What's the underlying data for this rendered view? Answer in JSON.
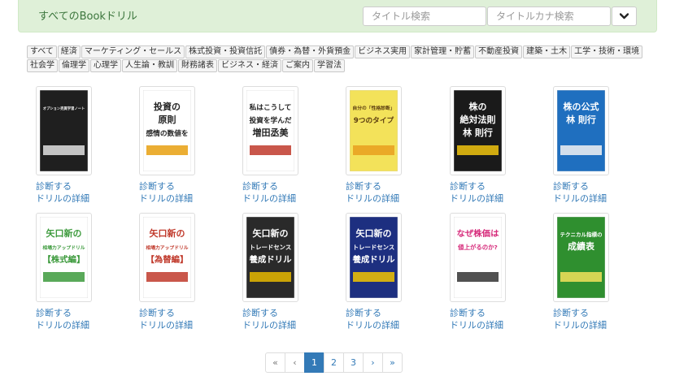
{
  "header": {
    "title": "すべてのBookドリル",
    "search_title_placeholder": "タイトル検索",
    "search_kana_placeholder": "タイトルカナ検索",
    "dropdown_icon": "chevron-down-icon"
  },
  "categories": [
    "すべて",
    "経済",
    "マーケティング・セールス",
    "株式投資・投資信託",
    "債券・為替・外貨預金",
    "ビジネス実用",
    "家計管理・貯蓄",
    "不動産投資",
    "建築・土木",
    "工学・技術・環境",
    "社会学",
    "倫理学",
    "心理学",
    "人生論・教訓",
    "財務諸表",
    "ビジネス・経済",
    "ご案内",
    "学習法"
  ],
  "book_link": {
    "line1": "診断する",
    "line2": "ドリルの詳細"
  },
  "books": [
    {
      "cover_lines": [
        "オプション売買学習ノート"
      ],
      "colors": [
        "#1f1f1f",
        "#f4f4f4",
        "#e0e0e0"
      ]
    },
    {
      "cover_lines": [
        "投資の",
        "原則",
        "感情の数値を"
      ],
      "colors": [
        "#ffffff",
        "#222222",
        "#e8a010"
      ]
    },
    {
      "cover_lines": [
        "私はこうして",
        "投資を学んだ",
        "増田丞美"
      ],
      "colors": [
        "#ffffff",
        "#222222",
        "#c0392b"
      ]
    },
    {
      "cover_lines": [
        "自分の「性格診断」",
        "9つのタイプ"
      ],
      "colors": [
        "#f3e25a",
        "#5a3b10",
        "#e89f1f"
      ]
    },
    {
      "cover_lines": [
        "株の",
        "絶対法則",
        "林 則行"
      ],
      "colors": [
        "#1a1a1a",
        "#ffffff",
        "#f1c40f"
      ]
    },
    {
      "cover_lines": [
        "株の公式",
        "林 則行"
      ],
      "colors": [
        "#1f6fbf",
        "#ffffff",
        "#f2f2f2"
      ]
    },
    {
      "cover_lines": [
        "矢口新の",
        "相場力アップドリル",
        "【株式編】"
      ],
      "colors": [
        "#ffffff",
        "#3c9a3c",
        "#3c9a3c"
      ]
    },
    {
      "cover_lines": [
        "矢口新の",
        "相場力アップドリル",
        "【為替編】"
      ],
      "colors": [
        "#ffffff",
        "#c0392b",
        "#c0392b"
      ]
    },
    {
      "cover_lines": [
        "矢口新の",
        "トレードセンス",
        "養成ドリル"
      ],
      "colors": [
        "#2a2a2a",
        "#ffffff",
        "#e6b800"
      ]
    },
    {
      "cover_lines": [
        "矢口新の",
        "トレードセンス",
        "養成ドリル"
      ],
      "colors": [
        "#1d2f80",
        "#ffffff",
        "#f2c400"
      ]
    },
    {
      "cover_lines": [
        "なぜ株価は",
        "値上がるのか?"
      ],
      "colors": [
        "#ffffff",
        "#d62a7a",
        "#333333"
      ]
    },
    {
      "cover_lines": [
        "テクニカル指標の",
        "成績表"
      ],
      "colors": [
        "#2f8f2f",
        "#ffffff",
        "#f3e25a"
      ]
    }
  ],
  "pagination": {
    "first": "«",
    "prev": "‹",
    "pages": [
      "1",
      "2",
      "3"
    ],
    "active": "1",
    "next": "›",
    "last": "»"
  }
}
